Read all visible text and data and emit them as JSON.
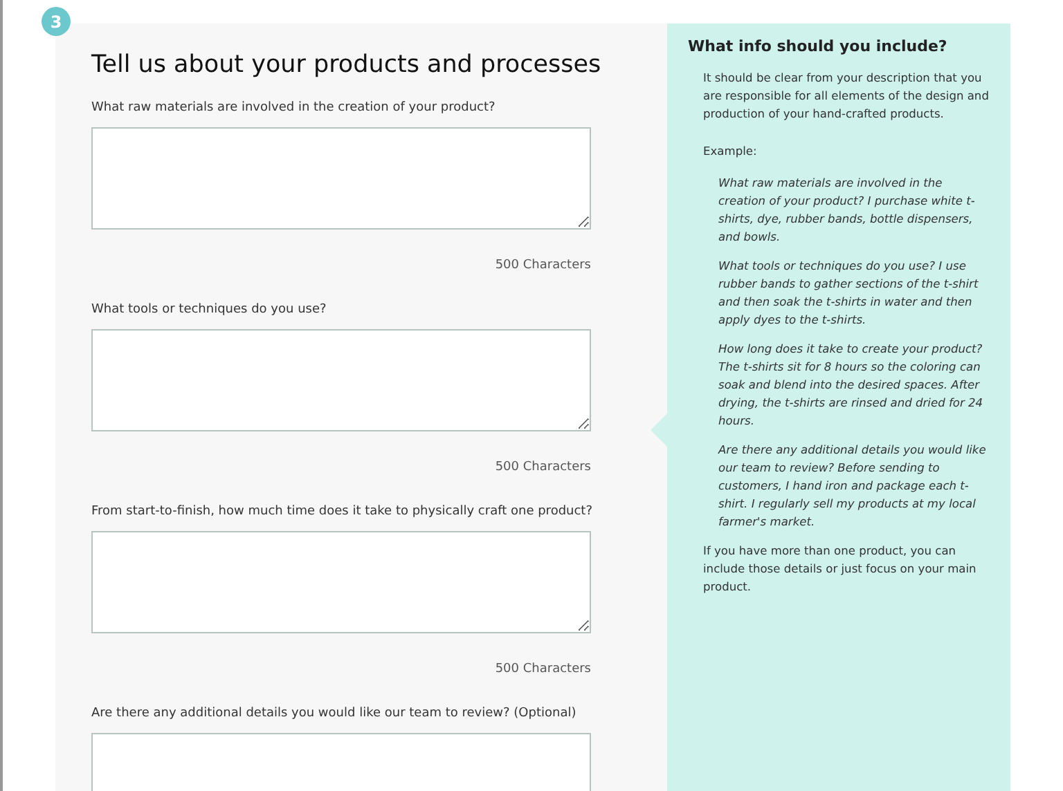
{
  "step": {
    "number": "3"
  },
  "form": {
    "title": "Tell us about your products and processes",
    "questions": [
      {
        "label": "What raw materials are involved in the creation of your product?",
        "counter": "500 Characters"
      },
      {
        "label": "What tools or techniques do you use?",
        "counter": "500 Characters"
      },
      {
        "label": "From start-to-finish, how much time does it take to physically craft one product?",
        "counter": "500 Characters"
      },
      {
        "label": "Are there any additional details you would like our team to review? (Optional)"
      }
    ]
  },
  "help": {
    "title": "What info should you include?",
    "intro": "It should be clear from your description that you are responsible for all elements of the design and production of your hand-crafted products.",
    "example_label": "Example:",
    "examples": [
      "What raw materials are involved in the creation of your product? I purchase white t-shirts, dye, rubber bands, bottle dispensers, and bowls.",
      "What tools or techniques do you use? I use rubber bands to gather sections of the t-shirt and then soak the t-shirts in water and then apply dyes to the t-shirts.",
      "How long does it take to create your product? The t-shirts sit for 8 hours so the coloring can soak and blend into the desired spaces. After drying, the t-shirts are rinsed and dried for 24 hours.",
      "Are there any additional details you would like our team to review? Before sending to customers, I hand iron and package each t-shirt. I regularly sell my products at my local farmer's market."
    ],
    "outro": "If you have more than one product, you can include those details or just focus on your main product."
  }
}
